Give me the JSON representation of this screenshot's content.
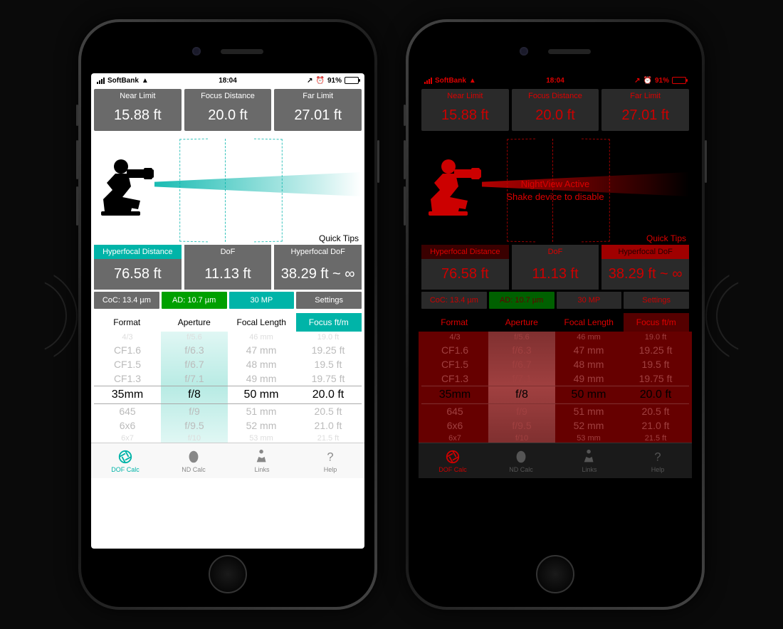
{
  "statusbar": {
    "carrier": "SoftBank",
    "time": "18:04",
    "battery_pct": "91%"
  },
  "dof": {
    "near_label": "Near Limit",
    "near_value": "15.88 ft",
    "focus_label": "Focus Distance",
    "focus_value": "20.0 ft",
    "far_label": "Far Limit",
    "far_value": "27.01 ft",
    "quick_tips": "Quick Tips",
    "hyperfocal_label": "Hyperfocal Distance",
    "hyperfocal_value": "76.58 ft",
    "dof_label": "DoF",
    "dof_value": "11.13 ft",
    "hyperdof_label": "Hyperfocal DoF",
    "hyperdof_value": "38.29 ft ~ ∞"
  },
  "buttons": {
    "coc": "CoC: 13.4 µm",
    "ad": "AD: 10.7 µm",
    "mp": "30 MP",
    "settings": "Settings"
  },
  "picker_headers": {
    "format": "Format",
    "aperture": "Aperture",
    "focal": "Focal Length",
    "focus": "Focus ft/m"
  },
  "pickers": {
    "format": [
      "4/3",
      "CF1.6",
      "CF1.5",
      "CF1.3",
      "35mm",
      "645",
      "6x6",
      "6x7"
    ],
    "aperture": [
      "f/5.6",
      "f/6.3",
      "f/6.7",
      "f/7.1",
      "f/8",
      "f/9",
      "f/9.5",
      "f/10"
    ],
    "focal": [
      "46 mm",
      "47 mm",
      "48 mm",
      "49 mm",
      "50 mm",
      "51 mm",
      "52 mm",
      "53 mm"
    ],
    "focus": [
      "19.0 ft",
      "19.25 ft",
      "19.5 ft",
      "19.75 ft",
      "20.0 ft",
      "20.5 ft",
      "21.0 ft",
      "21.5 ft"
    ]
  },
  "selected": {
    "format": "35mm",
    "aperture": "f/8",
    "focal": "50 mm",
    "focus": "20.0 ft"
  },
  "tabs": {
    "dof": "DOF Calc",
    "nd": "ND Calc",
    "links": "Links",
    "help": "Help"
  },
  "nightview": {
    "line1": "NightView Active",
    "line2": "Shake device to disable"
  }
}
